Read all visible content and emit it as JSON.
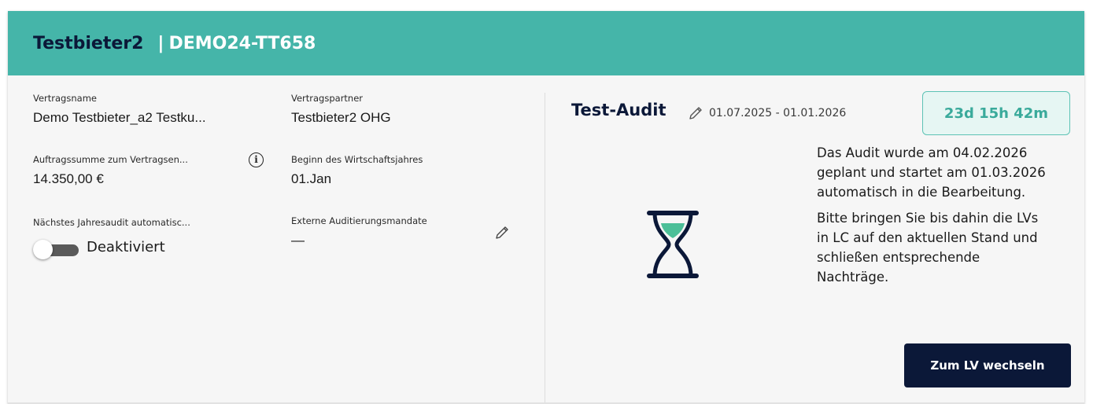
{
  "header": {
    "bidder_name": "Testbieter2",
    "separator": "|",
    "project_code": "DEMO24-TT658"
  },
  "contract": {
    "name": {
      "label": "Vertragsname",
      "value": "Demo Testbieter_a2 Testku..."
    },
    "partner": {
      "label": "Vertragspartner",
      "value": "Testbieter2 OHG"
    },
    "order_sum": {
      "label": "Auftragssumme zum Vertragsen...",
      "value": "14.350,00 €"
    },
    "fiscal_year_start": {
      "label": "Beginn des Wirtschaftsjahres",
      "value": "01.Jan"
    },
    "next_audit": {
      "label": "Nächstes Jahresaudit automatisc...",
      "toggle_label": "Deaktiviert",
      "enabled": false
    },
    "external_mandates": {
      "label": "Externe Auditierungsmandate",
      "value": "—"
    }
  },
  "audit": {
    "title": "Test-Audit",
    "date_range": "01.07.2025 - 01.01.2026",
    "countdown": "23d 15h 42m",
    "text_paragraph_1": "Das Audit wurde am 04.02.2026 geplant und startet am 01.03.2026 auto­matisch in die Bearbeitung.",
    "text_paragraph_2": "Bitte bringen Sie bis dahin die LVs in LC auf den aktuel­len Stand und schließen entsprechende Nachträge.",
    "button_label": "Zum LV wechseln"
  },
  "icons": {
    "info": "info-icon",
    "edit": "pencil-icon",
    "status": "hourglass-icon"
  },
  "colors": {
    "header_bg": "#45b5a9",
    "navy": "#0b1838",
    "accent_teal": "#3aaa9b",
    "countdown_bg": "#e6f6f3"
  }
}
